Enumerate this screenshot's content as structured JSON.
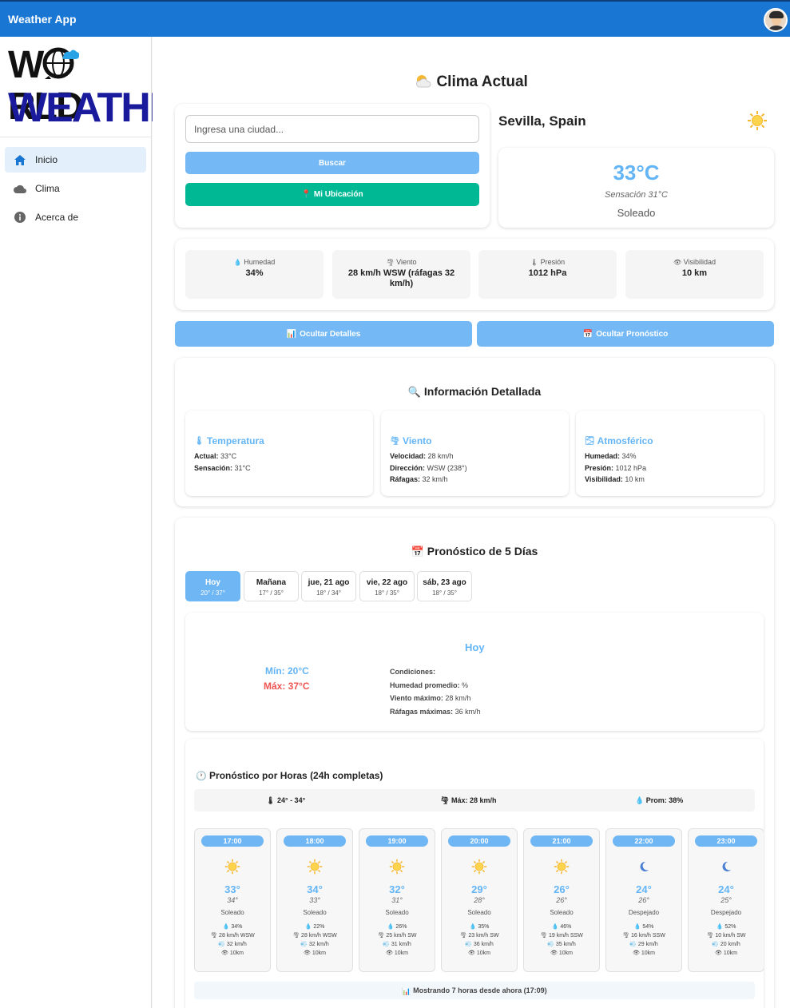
{
  "appbar": {
    "title": "Weather App"
  },
  "logo": {
    "line1_a": "W",
    "line1_b": "RLD",
    "line2": "WEATHER"
  },
  "nav": [
    {
      "label": "Inicio",
      "icon": "home-icon",
      "active": true
    },
    {
      "label": "Clima",
      "icon": "cloud-icon",
      "active": false
    },
    {
      "label": "Acerca de",
      "icon": "info-icon",
      "active": false
    }
  ],
  "current": {
    "heading": "Clima Actual",
    "search_placeholder": "Ingresa una ciudad...",
    "search_button": "Buscar",
    "location_button": "Mi Ubicación",
    "city": "Sevilla, Spain",
    "temp": "33°C",
    "feels": "Sensación 31°C",
    "condition": "Soleado"
  },
  "stats": [
    {
      "label": "Humedad",
      "value": "34%"
    },
    {
      "label": "Viento",
      "value": "28 km/h WSW (ráfagas 32 km/h)"
    },
    {
      "label": "Presión",
      "value": "1012 hPa"
    },
    {
      "label": "Visibilidad",
      "value": "10 km"
    }
  ],
  "toggles": {
    "details": "Ocultar Detalles",
    "forecast": "Ocultar Pronóstico"
  },
  "details": {
    "heading": "Información Detallada",
    "cards": [
      {
        "title": "Temperatura",
        "rows": [
          {
            "k": "Actual:",
            "v": "33°C"
          },
          {
            "k": "Sensación:",
            "v": "31°C"
          }
        ]
      },
      {
        "title": "Viento",
        "rows": [
          {
            "k": "Velocidad:",
            "v": "28 km/h"
          },
          {
            "k": "Dirección:",
            "v": "WSW (238°)"
          },
          {
            "k": "Ráfagas:",
            "v": "32 km/h"
          }
        ]
      },
      {
        "title": "Atmosférico",
        "rows": [
          {
            "k": "Humedad:",
            "v": "34%"
          },
          {
            "k": "Presión:",
            "v": "1012 hPa"
          },
          {
            "k": "Visibilidad:",
            "v": "10 km"
          }
        ]
      }
    ]
  },
  "forecast": {
    "heading": "Pronóstico de 5 Días",
    "tabs": [
      {
        "day": "Hoy",
        "range": "20° / 37°"
      },
      {
        "day": "Mañana",
        "range": "17° / 35°"
      },
      {
        "day": "jue, 21 ago",
        "range": "18° / 34°"
      },
      {
        "day": "vie, 22 ago",
        "range": "18° / 35°"
      },
      {
        "day": "sáb, 23 ago",
        "range": "18° / 35°"
      }
    ],
    "selected": {
      "title": "Hoy",
      "min": "Mín: 20°C",
      "max": "Máx: 37°C",
      "conditions_k": "Condiciones:",
      "conditions_v": "",
      "humidity_k": "Humedad promedio:",
      "humidity_v": "%",
      "wind_k": "Viento máximo:",
      "wind_v": "28 km/h",
      "gust_k": "Ráfagas máximas:",
      "gust_v": "36 km/h"
    }
  },
  "hourly": {
    "heading": "Pronóstico por Horas (24h completas)",
    "summary": {
      "temp": "24° - 34°",
      "wind": "Máx: 28 km/h",
      "hum": "Prom: 38%"
    },
    "footer": "Mostrando 7 horas desde ahora (17:09)",
    "hours": [
      {
        "time": "17:00",
        "icon": "sun",
        "temp": "33°",
        "feels": "34°",
        "cond": "Soleado",
        "hum": "34%",
        "wind": "28 km/h WSW",
        "gust": "32 km/h",
        "vis": "10km"
      },
      {
        "time": "18:00",
        "icon": "sun",
        "temp": "34°",
        "feels": "33°",
        "cond": "Soleado",
        "hum": "22%",
        "wind": "28 km/h WSW",
        "gust": "32 km/h",
        "vis": "10km"
      },
      {
        "time": "19:00",
        "icon": "sun",
        "temp": "32°",
        "feels": "31°",
        "cond": "Soleado",
        "hum": "26%",
        "wind": "25 km/h SW",
        "gust": "31 km/h",
        "vis": "10km"
      },
      {
        "time": "20:00",
        "icon": "sun",
        "temp": "29°",
        "feels": "28°",
        "cond": "Soleado",
        "hum": "35%",
        "wind": "23 km/h SW",
        "gust": "36 km/h",
        "vis": "10km"
      },
      {
        "time": "21:00",
        "icon": "sun",
        "temp": "26°",
        "feels": "26°",
        "cond": "Soleado",
        "hum": "46%",
        "wind": "19 km/h SSW",
        "gust": "35 km/h",
        "vis": "10km"
      },
      {
        "time": "22:00",
        "icon": "moon",
        "temp": "24°",
        "feels": "26°",
        "cond": "Despejado",
        "hum": "54%",
        "wind": "16 km/h SSW",
        "gust": "29 km/h",
        "vis": "10km"
      },
      {
        "time": "23:00",
        "icon": "moon",
        "temp": "24°",
        "feels": "25°",
        "cond": "Despejado",
        "hum": "52%",
        "wind": "10 km/h SW",
        "gust": "20 km/h",
        "vis": "10km"
      }
    ]
  },
  "colors": {
    "primary": "#1976d2",
    "accent_blue": "#6fb6f5",
    "temp_blue": "#64b5f6",
    "green": "#00b894",
    "max_red": "#ef5350"
  }
}
